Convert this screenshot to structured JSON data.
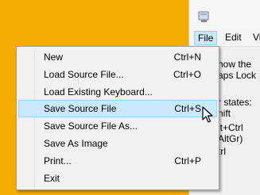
{
  "window": {
    "menubar": {
      "file": "File",
      "edit": "Edit",
      "view": "Vi"
    },
    "background_text": [
      "how the",
      "aps Lock",
      "r states:",
      "hift",
      "lt+Ctrl",
      "AltGr)",
      "trl"
    ]
  },
  "file_menu": {
    "items": [
      {
        "label": "New",
        "shortcut": "Ctrl+N"
      },
      {
        "label": "Load Source File...",
        "shortcut": "Ctrl+O"
      },
      {
        "label": "Load Existing Keyboard...",
        "shortcut": ""
      },
      {
        "label": "Save Source File",
        "shortcut": "Ctrl+S",
        "highlighted": true
      },
      {
        "label": "Save Source File As...",
        "shortcut": ""
      },
      {
        "label": "Save As Image",
        "shortcut": ""
      },
      {
        "label": "Print...",
        "shortcut": "Ctrl+P"
      },
      {
        "label": "Exit",
        "shortcut": ""
      }
    ]
  },
  "icons": {
    "app": "keyboard-app-icon",
    "cursor": "mouse-pointer-icon"
  },
  "colors": {
    "desktop": "#f4ac00",
    "highlight": "#cce8ff",
    "highlight_border": "#99d1ff"
  }
}
